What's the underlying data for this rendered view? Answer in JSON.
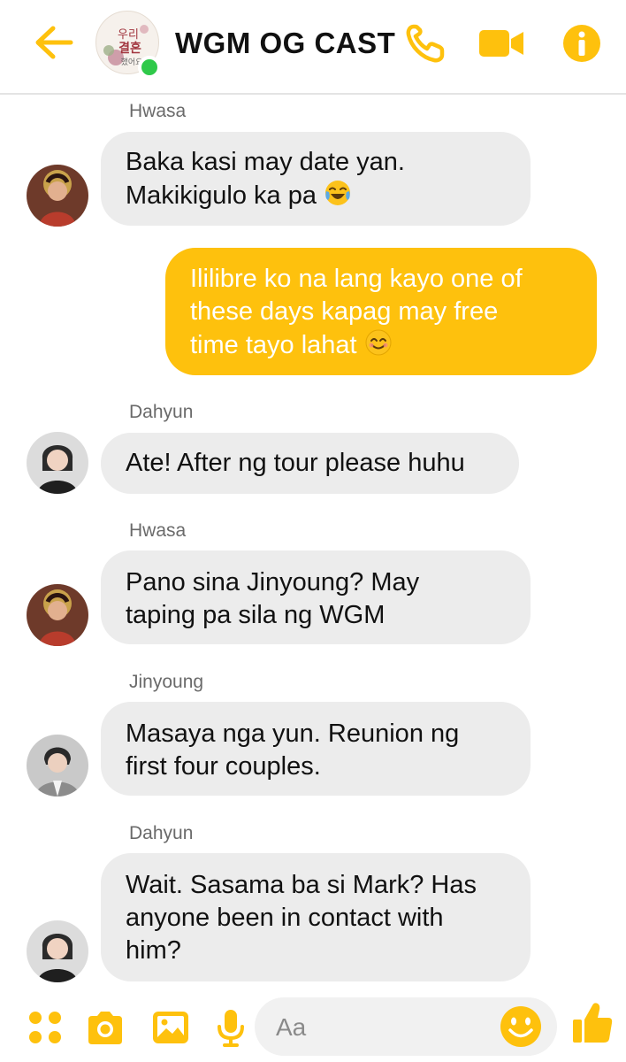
{
  "header": {
    "title": "WGM OG CAST",
    "avatar_text": "우리 결혼 했어요",
    "accent_color": "#fec10d",
    "online": true
  },
  "messages": [
    {
      "sender": "Hwasa",
      "text": "Baka kasi may date yan.\nMakikigulo ka pa",
      "emoji": "face-with-tears-of-joy",
      "mine": false,
      "avatar": "hwasa-avatar"
    },
    {
      "sender": "",
      "text": "Ililibre ko na lang kayo one of\nthese days kapag may free\ntime tayo lahat",
      "emoji": "smiling-face-with-smiling-eyes",
      "mine": true
    },
    {
      "sender": "Dahyun",
      "text": "Ate! After ng tour please huhu",
      "mine": false,
      "avatar": "dahyun-avatar"
    },
    {
      "sender": "Hwasa",
      "text": "Pano sina Jinyoung? May\ntaping pa sila ng WGM",
      "mine": false,
      "avatar": "hwasa-avatar"
    },
    {
      "sender": "Jinyoung",
      "text": "Masaya nga yun. Reunion ng\nfirst four couples.",
      "mine": false,
      "avatar": "jinyoung-avatar"
    },
    {
      "sender": "Dahyun",
      "text": "Wait. Sasama ba si Mark? Has\nanyone been in contact with\nhim?",
      "mine": false,
      "avatar": "dahyun-avatar"
    }
  ],
  "composer": {
    "placeholder": "Aa",
    "icons": [
      "apps-icon",
      "camera-icon",
      "gallery-icon",
      "microphone-icon",
      "emoji-icon",
      "like-icon"
    ]
  }
}
